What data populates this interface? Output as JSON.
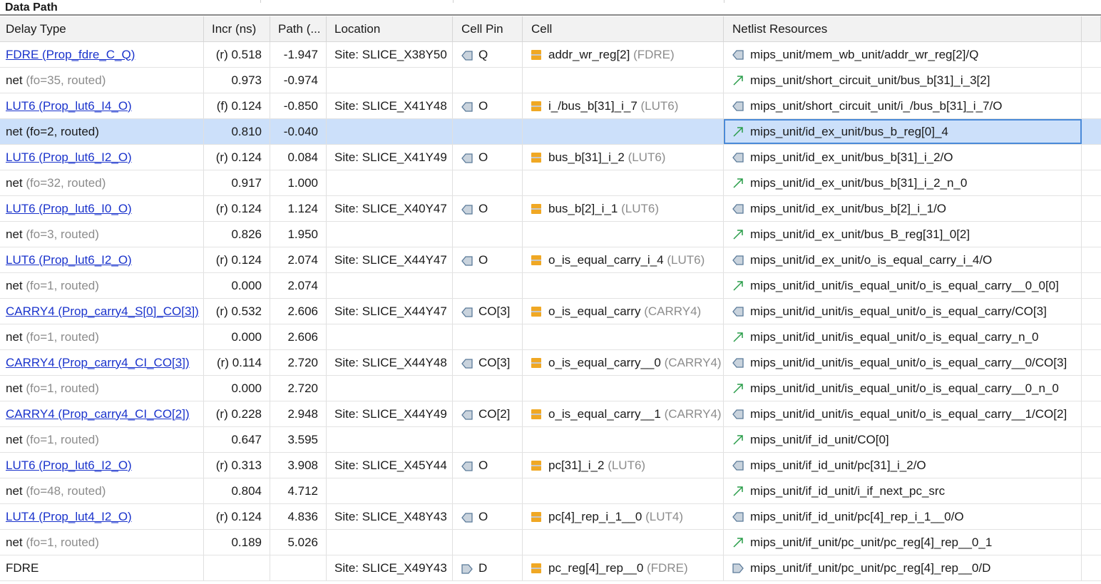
{
  "section": {
    "title": "Data Path"
  },
  "columns": [
    "Delay Type",
    "Incr (ns)",
    "Path (...",
    "Location",
    "Cell Pin",
    "Cell",
    "Netlist Resources"
  ],
  "rows": [
    {
      "delay_main": "FDRE (Prop_fdre_C_Q)",
      "delay_suffix": "",
      "link": true,
      "incr": "(r) 0.518",
      "path": "-1.947",
      "location": "Site: SLICE_X38Y50",
      "pin": "Q",
      "pin_icon": "pin-out-icon",
      "cell_name": "addr_wr_reg[2]",
      "cell_type": "(FDRE)",
      "net_icon": "pin-out-icon",
      "net": "mips_unit/mem_wb_unit/addr_wr_reg[2]/Q",
      "selected": false
    },
    {
      "delay_main": "net",
      "delay_suffix": "(fo=35, routed)",
      "link": false,
      "incr": "0.973",
      "path": "-0.974",
      "location": "",
      "pin": "",
      "pin_icon": "",
      "cell_name": "",
      "cell_type": "",
      "net_icon": "net-arrow-icon",
      "net": "mips_unit/short_circuit_unit/bus_b[31]_i_3[2]",
      "selected": false
    },
    {
      "delay_main": "LUT6 (Prop_lut6_I4_O)",
      "delay_suffix": "",
      "link": true,
      "incr": "(f) 0.124",
      "path": "-0.850",
      "location": "Site: SLICE_X41Y48",
      "pin": "O",
      "pin_icon": "pin-out-icon",
      "cell_name": "i_/bus_b[31]_i_7",
      "cell_type": "(LUT6)",
      "net_icon": "pin-out-icon",
      "net": "mips_unit/short_circuit_unit/i_/bus_b[31]_i_7/O",
      "selected": false
    },
    {
      "delay_main": "net (fo=2, routed)",
      "delay_suffix": "",
      "link": false,
      "incr": "0.810",
      "path": "-0.040",
      "location": "",
      "pin": "",
      "pin_icon": "",
      "cell_name": "",
      "cell_type": "",
      "net_icon": "net-arrow-icon",
      "net": "mips_unit/id_ex_unit/bus_b_reg[0]_4",
      "selected": true
    },
    {
      "delay_main": "LUT6 (Prop_lut6_I2_O)",
      "delay_suffix": "",
      "link": true,
      "incr": "(r) 0.124",
      "path": "0.084",
      "location": "Site: SLICE_X41Y49",
      "pin": "O",
      "pin_icon": "pin-out-icon",
      "cell_name": "bus_b[31]_i_2",
      "cell_type": "(LUT6)",
      "net_icon": "pin-out-icon",
      "net": "mips_unit/id_ex_unit/bus_b[31]_i_2/O",
      "selected": false
    },
    {
      "delay_main": "net",
      "delay_suffix": "(fo=32, routed)",
      "link": false,
      "incr": "0.917",
      "path": "1.000",
      "location": "",
      "pin": "",
      "pin_icon": "",
      "cell_name": "",
      "cell_type": "",
      "net_icon": "net-arrow-icon",
      "net": "mips_unit/id_ex_unit/bus_b[31]_i_2_n_0",
      "selected": false
    },
    {
      "delay_main": "LUT6 (Prop_lut6_I0_O)",
      "delay_suffix": "",
      "link": true,
      "incr": "(r) 0.124",
      "path": "1.124",
      "location": "Site: SLICE_X40Y47",
      "pin": "O",
      "pin_icon": "pin-out-icon",
      "cell_name": "bus_b[2]_i_1",
      "cell_type": "(LUT6)",
      "net_icon": "pin-out-icon",
      "net": "mips_unit/id_ex_unit/bus_b[2]_i_1/O",
      "selected": false
    },
    {
      "delay_main": "net",
      "delay_suffix": "(fo=3, routed)",
      "link": false,
      "incr": "0.826",
      "path": "1.950",
      "location": "",
      "pin": "",
      "pin_icon": "",
      "cell_name": "",
      "cell_type": "",
      "net_icon": "net-arrow-icon",
      "net": "mips_unit/id_ex_unit/bus_B_reg[31]_0[2]",
      "selected": false
    },
    {
      "delay_main": "LUT6 (Prop_lut6_I2_O)",
      "delay_suffix": "",
      "link": true,
      "incr": "(r) 0.124",
      "path": "2.074",
      "location": "Site: SLICE_X44Y47",
      "pin": "O",
      "pin_icon": "pin-out-icon",
      "cell_name": "o_is_equal_carry_i_4",
      "cell_type": "(LUT6)",
      "net_icon": "pin-out-icon",
      "net": "mips_unit/id_ex_unit/o_is_equal_carry_i_4/O",
      "selected": false
    },
    {
      "delay_main": "net",
      "delay_suffix": "(fo=1, routed)",
      "link": false,
      "incr": "0.000",
      "path": "2.074",
      "location": "",
      "pin": "",
      "pin_icon": "",
      "cell_name": "",
      "cell_type": "",
      "net_icon": "net-arrow-icon",
      "net": "mips_unit/id_unit/is_equal_unit/o_is_equal_carry__0_0[0]",
      "selected": false
    },
    {
      "delay_main": "CARRY4 (Prop_carry4_S[0]_CO[3])",
      "delay_suffix": "",
      "link": true,
      "incr": "(r) 0.532",
      "path": "2.606",
      "location": "Site: SLICE_X44Y47",
      "pin": "CO[3]",
      "pin_icon": "pin-out-icon",
      "cell_name": "o_is_equal_carry",
      "cell_type": "(CARRY4)",
      "net_icon": "pin-out-icon",
      "net": "mips_unit/id_unit/is_equal_unit/o_is_equal_carry/CO[3]",
      "selected": false
    },
    {
      "delay_main": "net",
      "delay_suffix": "(fo=1, routed)",
      "link": false,
      "incr": "0.000",
      "path": "2.606",
      "location": "",
      "pin": "",
      "pin_icon": "",
      "cell_name": "",
      "cell_type": "",
      "net_icon": "net-arrow-icon",
      "net": "mips_unit/id_unit/is_equal_unit/o_is_equal_carry_n_0",
      "selected": false
    },
    {
      "delay_main": "CARRY4 (Prop_carry4_CI_CO[3])",
      "delay_suffix": "",
      "link": true,
      "incr": "(r) 0.114",
      "path": "2.720",
      "location": "Site: SLICE_X44Y48",
      "pin": "CO[3]",
      "pin_icon": "pin-out-icon",
      "cell_name": "o_is_equal_carry__0",
      "cell_type": "(CARRY4)",
      "net_icon": "pin-out-icon",
      "net": "mips_unit/id_unit/is_equal_unit/o_is_equal_carry__0/CO[3]",
      "selected": false
    },
    {
      "delay_main": "net",
      "delay_suffix": "(fo=1, routed)",
      "link": false,
      "incr": "0.000",
      "path": "2.720",
      "location": "",
      "pin": "",
      "pin_icon": "",
      "cell_name": "",
      "cell_type": "",
      "net_icon": "net-arrow-icon",
      "net": "mips_unit/id_unit/is_equal_unit/o_is_equal_carry__0_n_0",
      "selected": false
    },
    {
      "delay_main": "CARRY4 (Prop_carry4_CI_CO[2])",
      "delay_suffix": "",
      "link": true,
      "incr": "(r) 0.228",
      "path": "2.948",
      "location": "Site: SLICE_X44Y49",
      "pin": "CO[2]",
      "pin_icon": "pin-out-icon",
      "cell_name": "o_is_equal_carry__1",
      "cell_type": "(CARRY4)",
      "net_icon": "pin-out-icon",
      "net": "mips_unit/id_unit/is_equal_unit/o_is_equal_carry__1/CO[2]",
      "selected": false
    },
    {
      "delay_main": "net",
      "delay_suffix": "(fo=1, routed)",
      "link": false,
      "incr": "0.647",
      "path": "3.595",
      "location": "",
      "pin": "",
      "pin_icon": "",
      "cell_name": "",
      "cell_type": "",
      "net_icon": "net-arrow-icon",
      "net": "mips_unit/if_id_unit/CO[0]",
      "selected": false
    },
    {
      "delay_main": "LUT6 (Prop_lut6_I2_O)",
      "delay_suffix": "",
      "link": true,
      "incr": "(r) 0.313",
      "path": "3.908",
      "location": "Site: SLICE_X45Y44",
      "pin": "O",
      "pin_icon": "pin-out-icon",
      "cell_name": "pc[31]_i_2",
      "cell_type": "(LUT6)",
      "net_icon": "pin-out-icon",
      "net": "mips_unit/if_id_unit/pc[31]_i_2/O",
      "selected": false
    },
    {
      "delay_main": "net",
      "delay_suffix": "(fo=48, routed)",
      "link": false,
      "incr": "0.804",
      "path": "4.712",
      "location": "",
      "pin": "",
      "pin_icon": "",
      "cell_name": "",
      "cell_type": "",
      "net_icon": "net-arrow-icon",
      "net": "mips_unit/if_id_unit/i_if_next_pc_src",
      "selected": false
    },
    {
      "delay_main": "LUT4 (Prop_lut4_I2_O)",
      "delay_suffix": "",
      "link": true,
      "incr": "(r) 0.124",
      "path": "4.836",
      "location": "Site: SLICE_X48Y43",
      "pin": "O",
      "pin_icon": "pin-out-icon",
      "cell_name": "pc[4]_rep_i_1__0",
      "cell_type": "(LUT4)",
      "net_icon": "pin-out-icon",
      "net": "mips_unit/if_id_unit/pc[4]_rep_i_1__0/O",
      "selected": false
    },
    {
      "delay_main": "net",
      "delay_suffix": "(fo=1, routed)",
      "link": false,
      "incr": "0.189",
      "path": "5.026",
      "location": "",
      "pin": "",
      "pin_icon": "",
      "cell_name": "",
      "cell_type": "",
      "net_icon": "net-arrow-icon",
      "net": "mips_unit/if_unit/pc_unit/pc_reg[4]_rep__0_1",
      "selected": false
    },
    {
      "delay_main": "FDRE",
      "delay_suffix": "",
      "link": false,
      "incr": "",
      "path": "",
      "location": "Site: SLICE_X49Y43",
      "pin": "D",
      "pin_icon": "pin-in-icon",
      "cell_name": "pc_reg[4]_rep__0",
      "cell_type": "(FDRE)",
      "net_icon": "pin-in-icon",
      "net": "mips_unit/if_unit/pc_unit/pc_reg[4]_rep__0/D",
      "selected": false
    }
  ],
  "colors": {
    "link": "#1a33cc",
    "selection": "#cce0fa",
    "cell_icon": "#f0a824",
    "net_arrow": "#2a9d4a",
    "pin_icon": "#5a7a99"
  }
}
